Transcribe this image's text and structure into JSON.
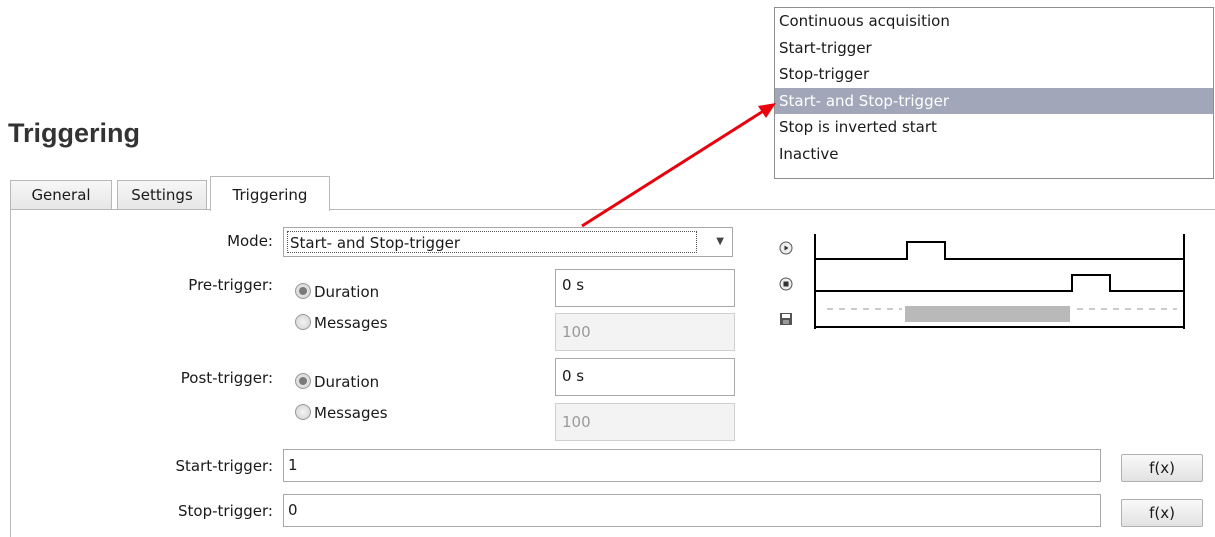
{
  "heading": "Triggering",
  "tabs": [
    {
      "label": "General",
      "active": false
    },
    {
      "label": "Settings",
      "active": false
    },
    {
      "label": "Triggering",
      "active": true
    }
  ],
  "form": {
    "mode": {
      "label": "Mode:",
      "value": "Start- and Stop-trigger"
    },
    "pre_trigger": {
      "label": "Pre-trigger:",
      "options": [
        {
          "label": "Duration",
          "selected": true,
          "value": "0 s"
        },
        {
          "label": "Messages",
          "selected": false,
          "value": "100"
        }
      ]
    },
    "post_trigger": {
      "label": "Post-trigger:",
      "options": [
        {
          "label": "Duration",
          "selected": true,
          "value": "0 s"
        },
        {
          "label": "Messages",
          "selected": false,
          "value": "100"
        }
      ]
    },
    "start_trigger": {
      "label": "Start-trigger:",
      "value": "1",
      "button": "f(x)"
    },
    "stop_trigger": {
      "label": "Stop-trigger:",
      "value": "0",
      "button": "f(x)"
    }
  },
  "mode_dropdown": {
    "items": [
      "Continuous acquisition",
      "Start-trigger",
      "Stop-trigger",
      "Start- and Stop-trigger",
      "Stop is inverted start",
      "Inactive"
    ],
    "selected_index": 3
  },
  "diagram_icons": [
    "play-icon",
    "stop-icon",
    "save-icon"
  ],
  "colors": {
    "annotation_arrow": "#e8000c",
    "dropdown_highlight": "#a1a7b8"
  }
}
